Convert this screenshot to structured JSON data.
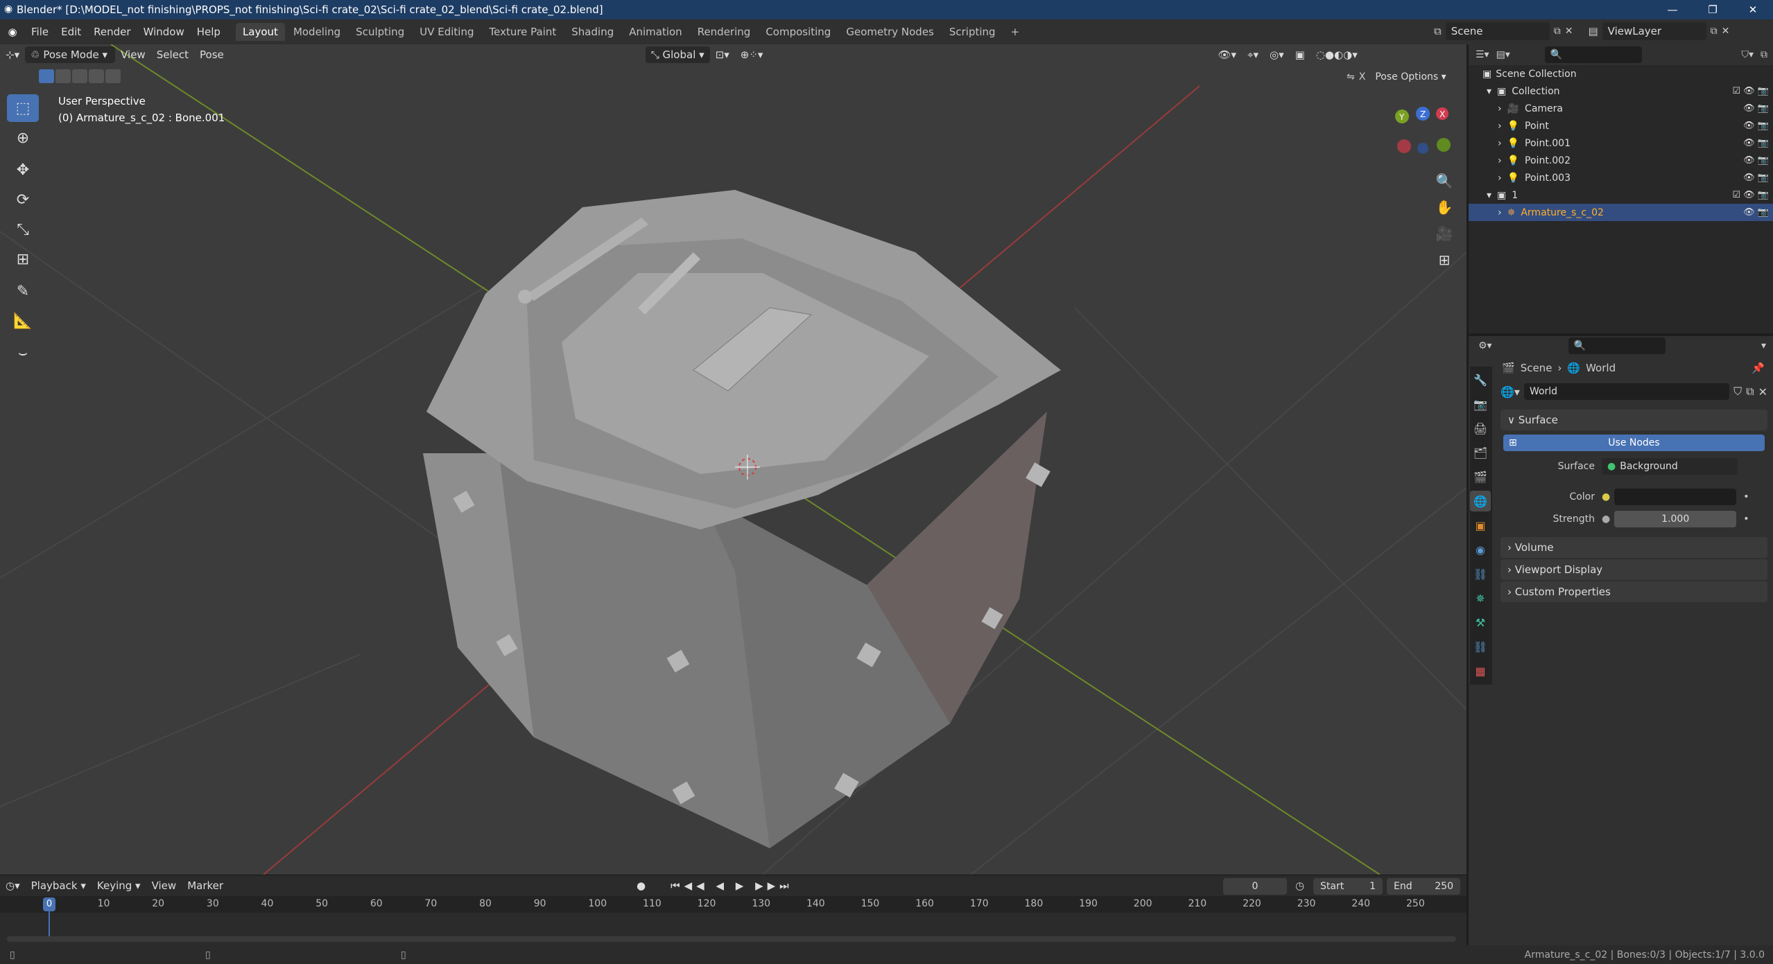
{
  "window": {
    "title": "Blender* [D:\\MODEL_not finishing\\PROPS_not finishing\\Sci-fi crate_02\\Sci-fi crate_02_blend\\Sci-fi crate_02.blend]",
    "minimize": "—",
    "maximize": "❐",
    "close": "✕"
  },
  "menus": [
    "File",
    "Edit",
    "Render",
    "Window",
    "Help"
  ],
  "workspaces": [
    "Layout",
    "Modeling",
    "Sculpting",
    "UV Editing",
    "Texture Paint",
    "Shading",
    "Animation",
    "Rendering",
    "Compositing",
    "Geometry Nodes",
    "Scripting"
  ],
  "add_tab": "+",
  "scene": {
    "label": "Scene"
  },
  "viewlayer": {
    "label": "ViewLayer"
  },
  "viewport": {
    "mode": "Pose Mode",
    "menu": [
      "View",
      "Select",
      "Pose"
    ],
    "orientation": "Global",
    "pose_options": "Pose Options",
    "perspective": "User Perspective",
    "active": "(0) Armature_s_c_02 : Bone.001",
    "gizmo": {
      "x": "X",
      "y": "Y",
      "z": "Z"
    }
  },
  "outliner": {
    "root": "Scene Collection",
    "rows": [
      {
        "label": "Collection",
        "indent": 1
      },
      {
        "label": "Camera",
        "indent": 2
      },
      {
        "label": "Point",
        "indent": 2
      },
      {
        "label": "Point.001",
        "indent": 2
      },
      {
        "label": "Point.002",
        "indent": 2
      },
      {
        "label": "Point.003",
        "indent": 2
      },
      {
        "label": "1",
        "indent": 1
      },
      {
        "label": "Armature_s_c_02",
        "indent": 2,
        "selected": true
      }
    ]
  },
  "properties": {
    "breadcrumb": [
      "Scene",
      "World"
    ],
    "world_name": "World",
    "surface_header": "Surface",
    "use_nodes": "Use Nodes",
    "surface_label": "Surface",
    "surface_value": "Background",
    "color_label": "Color",
    "strength_label": "Strength",
    "strength_value": "1.000",
    "sections": [
      "Volume",
      "Viewport Display",
      "Custom Properties"
    ]
  },
  "timeline": {
    "menus": [
      "Playback",
      "Keying",
      "View",
      "Marker"
    ],
    "current_frame": "0",
    "start_label": "Start",
    "start": "1",
    "end_label": "End",
    "end": "250",
    "ticks": [
      "0",
      "10",
      "20",
      "30",
      "40",
      "50",
      "60",
      "70",
      "80",
      "90",
      "100",
      "110",
      "120",
      "130",
      "140",
      "150",
      "160",
      "170",
      "180",
      "190",
      "200",
      "210",
      "220",
      "230",
      "240",
      "250"
    ]
  },
  "status": "Armature_s_c_02 | Bones:0/3 | Objects:1/7 | 3.0.0"
}
